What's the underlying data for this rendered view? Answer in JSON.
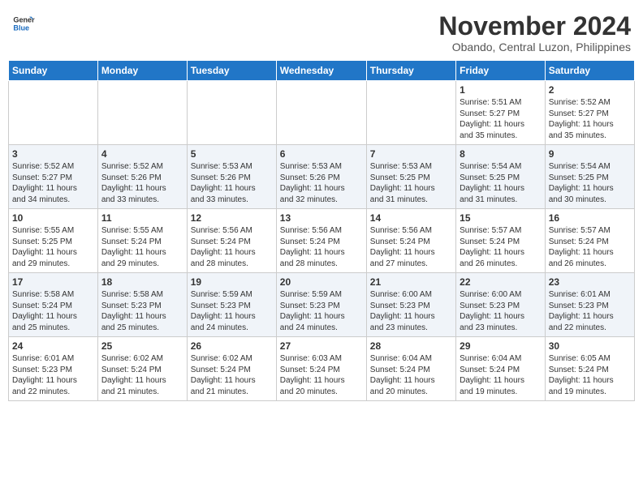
{
  "header": {
    "logo_general": "General",
    "logo_blue": "Blue",
    "month": "November 2024",
    "location": "Obando, Central Luzon, Philippines"
  },
  "weekdays": [
    "Sunday",
    "Monday",
    "Tuesday",
    "Wednesday",
    "Thursday",
    "Friday",
    "Saturday"
  ],
  "weeks": [
    [
      {
        "day": "",
        "info": ""
      },
      {
        "day": "",
        "info": ""
      },
      {
        "day": "",
        "info": ""
      },
      {
        "day": "",
        "info": ""
      },
      {
        "day": "",
        "info": ""
      },
      {
        "day": "1",
        "info": "Sunrise: 5:51 AM\nSunset: 5:27 PM\nDaylight: 11 hours\nand 35 minutes."
      },
      {
        "day": "2",
        "info": "Sunrise: 5:52 AM\nSunset: 5:27 PM\nDaylight: 11 hours\nand 35 minutes."
      }
    ],
    [
      {
        "day": "3",
        "info": "Sunrise: 5:52 AM\nSunset: 5:27 PM\nDaylight: 11 hours\nand 34 minutes."
      },
      {
        "day": "4",
        "info": "Sunrise: 5:52 AM\nSunset: 5:26 PM\nDaylight: 11 hours\nand 33 minutes."
      },
      {
        "day": "5",
        "info": "Sunrise: 5:53 AM\nSunset: 5:26 PM\nDaylight: 11 hours\nand 33 minutes."
      },
      {
        "day": "6",
        "info": "Sunrise: 5:53 AM\nSunset: 5:26 PM\nDaylight: 11 hours\nand 32 minutes."
      },
      {
        "day": "7",
        "info": "Sunrise: 5:53 AM\nSunset: 5:25 PM\nDaylight: 11 hours\nand 31 minutes."
      },
      {
        "day": "8",
        "info": "Sunrise: 5:54 AM\nSunset: 5:25 PM\nDaylight: 11 hours\nand 31 minutes."
      },
      {
        "day": "9",
        "info": "Sunrise: 5:54 AM\nSunset: 5:25 PM\nDaylight: 11 hours\nand 30 minutes."
      }
    ],
    [
      {
        "day": "10",
        "info": "Sunrise: 5:55 AM\nSunset: 5:25 PM\nDaylight: 11 hours\nand 29 minutes."
      },
      {
        "day": "11",
        "info": "Sunrise: 5:55 AM\nSunset: 5:24 PM\nDaylight: 11 hours\nand 29 minutes."
      },
      {
        "day": "12",
        "info": "Sunrise: 5:56 AM\nSunset: 5:24 PM\nDaylight: 11 hours\nand 28 minutes."
      },
      {
        "day": "13",
        "info": "Sunrise: 5:56 AM\nSunset: 5:24 PM\nDaylight: 11 hours\nand 28 minutes."
      },
      {
        "day": "14",
        "info": "Sunrise: 5:56 AM\nSunset: 5:24 PM\nDaylight: 11 hours\nand 27 minutes."
      },
      {
        "day": "15",
        "info": "Sunrise: 5:57 AM\nSunset: 5:24 PM\nDaylight: 11 hours\nand 26 minutes."
      },
      {
        "day": "16",
        "info": "Sunrise: 5:57 AM\nSunset: 5:24 PM\nDaylight: 11 hours\nand 26 minutes."
      }
    ],
    [
      {
        "day": "17",
        "info": "Sunrise: 5:58 AM\nSunset: 5:24 PM\nDaylight: 11 hours\nand 25 minutes."
      },
      {
        "day": "18",
        "info": "Sunrise: 5:58 AM\nSunset: 5:23 PM\nDaylight: 11 hours\nand 25 minutes."
      },
      {
        "day": "19",
        "info": "Sunrise: 5:59 AM\nSunset: 5:23 PM\nDaylight: 11 hours\nand 24 minutes."
      },
      {
        "day": "20",
        "info": "Sunrise: 5:59 AM\nSunset: 5:23 PM\nDaylight: 11 hours\nand 24 minutes."
      },
      {
        "day": "21",
        "info": "Sunrise: 6:00 AM\nSunset: 5:23 PM\nDaylight: 11 hours\nand 23 minutes."
      },
      {
        "day": "22",
        "info": "Sunrise: 6:00 AM\nSunset: 5:23 PM\nDaylight: 11 hours\nand 23 minutes."
      },
      {
        "day": "23",
        "info": "Sunrise: 6:01 AM\nSunset: 5:23 PM\nDaylight: 11 hours\nand 22 minutes."
      }
    ],
    [
      {
        "day": "24",
        "info": "Sunrise: 6:01 AM\nSunset: 5:23 PM\nDaylight: 11 hours\nand 22 minutes."
      },
      {
        "day": "25",
        "info": "Sunrise: 6:02 AM\nSunset: 5:24 PM\nDaylight: 11 hours\nand 21 minutes."
      },
      {
        "day": "26",
        "info": "Sunrise: 6:02 AM\nSunset: 5:24 PM\nDaylight: 11 hours\nand 21 minutes."
      },
      {
        "day": "27",
        "info": "Sunrise: 6:03 AM\nSunset: 5:24 PM\nDaylight: 11 hours\nand 20 minutes."
      },
      {
        "day": "28",
        "info": "Sunrise: 6:04 AM\nSunset: 5:24 PM\nDaylight: 11 hours\nand 20 minutes."
      },
      {
        "day": "29",
        "info": "Sunrise: 6:04 AM\nSunset: 5:24 PM\nDaylight: 11 hours\nand 19 minutes."
      },
      {
        "day": "30",
        "info": "Sunrise: 6:05 AM\nSunset: 5:24 PM\nDaylight: 11 hours\nand 19 minutes."
      }
    ]
  ]
}
